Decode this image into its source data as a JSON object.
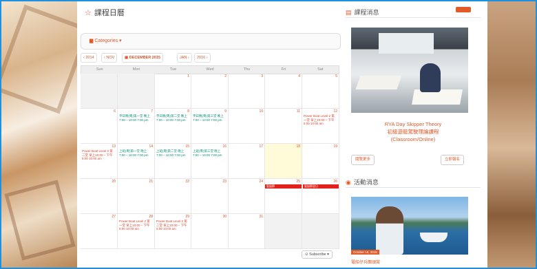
{
  "page": {
    "title": "課程日曆"
  },
  "toolbar": {
    "categories_label": "Categories",
    "prev_year": "‹ 2014",
    "prev_month": "‹ NOV",
    "month_title": "DECEMBER 2015",
    "next_month": "JAN ›",
    "next_year": "2016 ›"
  },
  "calendar": {
    "weekdays": [
      "Sun",
      "Mon",
      "Tue",
      "Wed",
      "Thu",
      "Fri",
      "Sat"
    ],
    "weeks": [
      {
        "days": [
          "",
          "",
          "1",
          "2",
          "3",
          "4",
          "5"
        ]
      },
      {
        "days": [
          "6",
          "7",
          "8",
          "9",
          "10",
          "11",
          "12"
        ]
      },
      {
        "days": [
          "13",
          "14",
          "15",
          "16",
          "17",
          "18",
          "19"
        ]
      },
      {
        "days": [
          "20",
          "21",
          "22",
          "23",
          "24",
          "25",
          "26"
        ]
      },
      {
        "days": [
          "27",
          "28",
          "29",
          "30",
          "31",
          "",
          ""
        ]
      }
    ],
    "events": {
      "w1_mon": "平日晚(粵)第一堂 晚上 7:00 – 10:00 7:00 pm",
      "w1_tue": "平日晚(粵)第二堂 晚上 7:00 – 10:00 7:00 pm",
      "w1_wed": "平日晚(粵)第三堂 晚上 7:00 – 10:00 7:00 pm",
      "w1_sat": "Power Boat Level 2 第一堂 早上10:00 – 下午5:00 10:00 am",
      "w2_sun": "Power Boat Level 2 第二堂 早上10:00 – 下午5:00 10:00 am",
      "w2_mon": "上班(粵)第一堂 晚上 7:00 – 10:00 7:00 pm",
      "w2_tue": "上班(粵)第二堂 晚上 7:00 – 10:00 7:00 pm",
      "w2_wed": "上班(粵)第三堂 晚上 7:00 – 10:00 7:00 pm",
      "w3_fri_bar": "聖誕節",
      "w3_sat_bar": "聖誕節翌日",
      "w4_mon": "Power Boat Level 2 第一堂 早上10:00 – 下午5:00 10:00 am",
      "w4_tue": "Power Boat Level 2 第二堂 早上10:00 – 下午5:00 10:00 am"
    },
    "subscribe_label": "Subscribe"
  },
  "sidebar": {
    "course_news_title": "課程消息",
    "course_name_line1": "RYA Day Skipper Theory",
    "course_name_line2": "初級遊艇駕駛理論課程",
    "course_name_line3": "(Classroom/Online)",
    "more_label": "閱覽更多",
    "register_label": "立即報名",
    "activity_title": "活動消息",
    "activity_date": "October 18, 2015",
    "activity_caption": "電船仔兵團頭賞"
  },
  "colors": {
    "accent": "#e05a2a",
    "teal": "#0a8f7a",
    "holiday": "#e2221a",
    "frame": "#1e90e0"
  }
}
